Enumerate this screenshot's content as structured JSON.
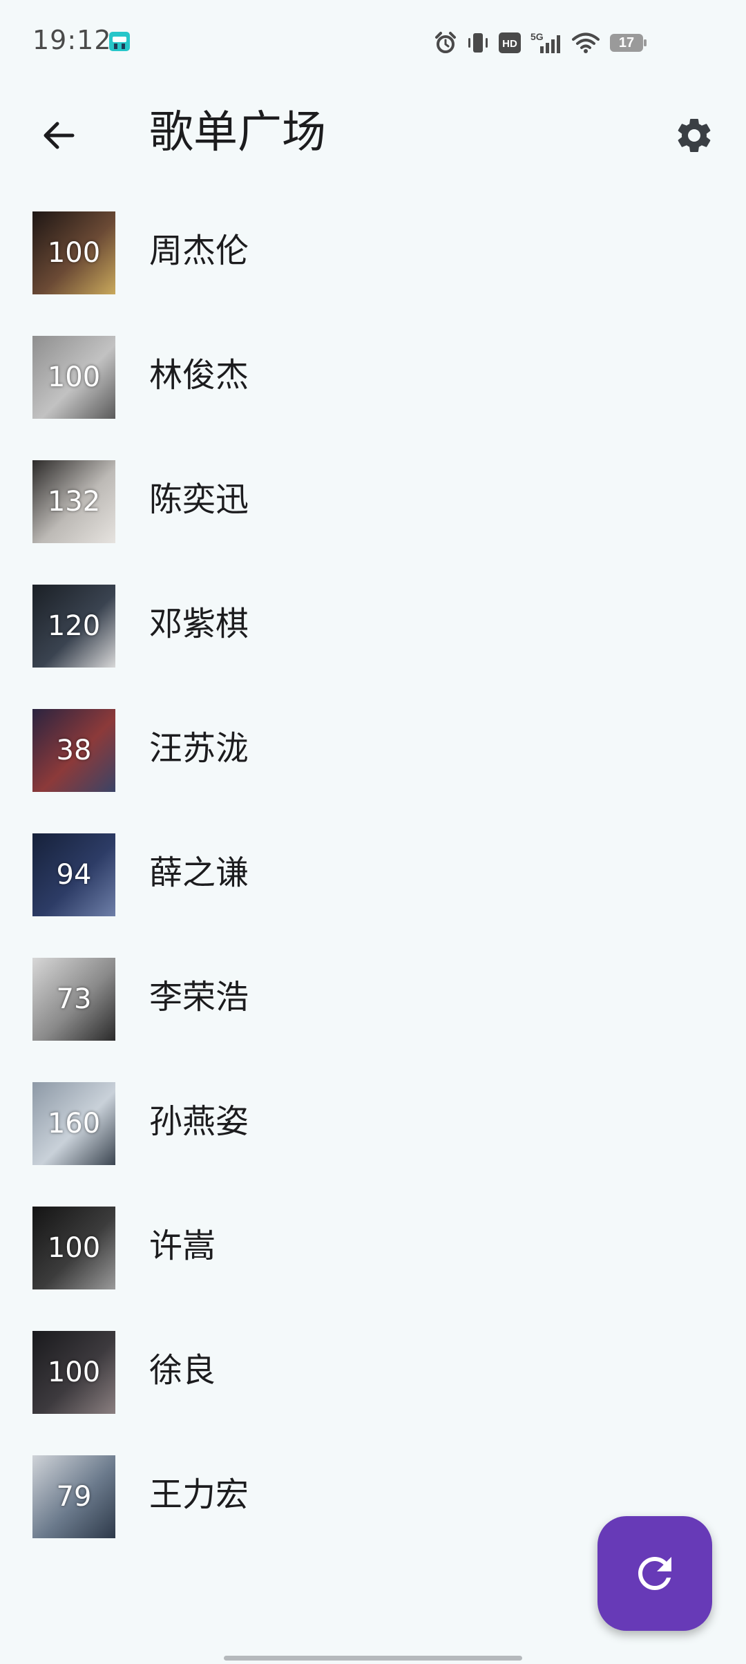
{
  "status_bar": {
    "time": "19:12",
    "battery_level": "17",
    "network": "5G",
    "hd_badge": "HD",
    "icons": [
      "alarm-icon",
      "vibrate-icon",
      "hd-icon",
      "signal-5g-icon",
      "wifi-icon",
      "battery-icon"
    ]
  },
  "app_bar": {
    "title": "歌单广场",
    "back_icon": "arrow-back-icon",
    "settings_icon": "gear-icon"
  },
  "playlists": [
    {
      "name": "周杰伦",
      "count": "100",
      "colors": [
        "#1f1715",
        "#6b4a35",
        "#c9a95c"
      ]
    },
    {
      "name": "林俊杰",
      "count": "100",
      "colors": [
        "#8f8f8f",
        "#c2c2c2",
        "#5a5a5a"
      ]
    },
    {
      "name": "陈奕迅",
      "count": "132",
      "colors": [
        "#2d2b2a",
        "#bdbab6",
        "#e6e3df"
      ]
    },
    {
      "name": "邓紫棋",
      "count": "120",
      "colors": [
        "#1b2026",
        "#3a4350",
        "#d8d8d8"
      ]
    },
    {
      "name": "汪苏泷",
      "count": "38",
      "colors": [
        "#2b2440",
        "#8c3a3a",
        "#3a4466"
      ]
    },
    {
      "name": "薛之谦",
      "count": "94",
      "colors": [
        "#16213a",
        "#2d3c66",
        "#6e7fa8"
      ]
    },
    {
      "name": "李荣浩",
      "count": "73",
      "colors": [
        "#d7d7d7",
        "#8a8a8a",
        "#2a2a2a"
      ]
    },
    {
      "name": "孙燕姿",
      "count": "160",
      "colors": [
        "#8d99a6",
        "#c9d1d9",
        "#3b4550"
      ]
    },
    {
      "name": "许嵩",
      "count": "100",
      "colors": [
        "#141414",
        "#3c3c3c",
        "#9a9a9a"
      ]
    },
    {
      "name": "徐良",
      "count": "100",
      "colors": [
        "#1a1a1d",
        "#3d3a3e",
        "#8a7f80"
      ]
    },
    {
      "name": "王力宏",
      "count": "79",
      "colors": [
        "#cfd3d8",
        "#6b7a8c",
        "#2e3a4a"
      ]
    }
  ],
  "fab": {
    "icon": "refresh-icon",
    "color": "#673ab7"
  },
  "colors": {
    "background": "#f4f9fa",
    "accent": "#673ab7",
    "text": "#1c1c1e"
  }
}
